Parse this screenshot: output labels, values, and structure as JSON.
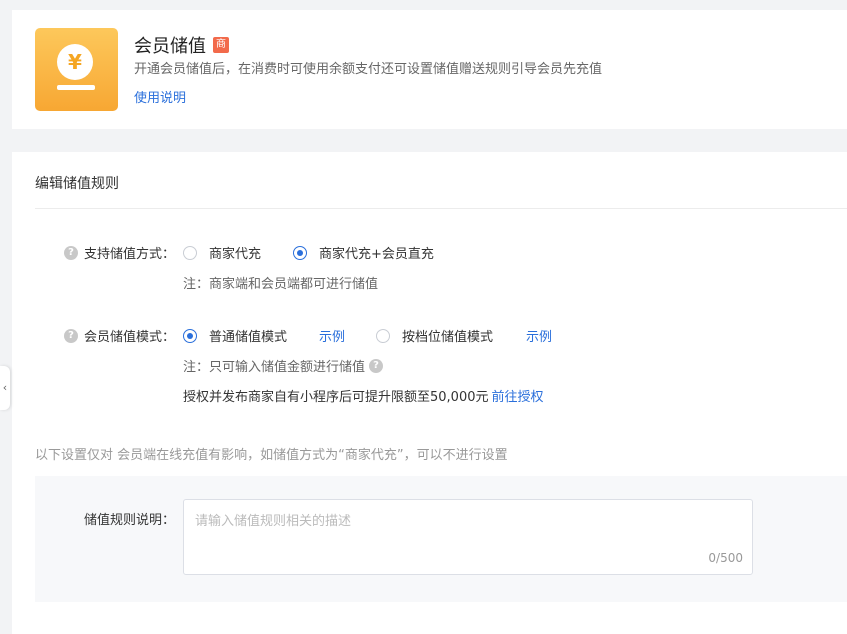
{
  "header": {
    "icon_symbol": "¥",
    "title": "会员储值",
    "badge": "商",
    "subtitle": "开通会员储值后，在消费时可使用余额支付还可设置储值赠送规则引导会员先充值",
    "help_link": "使用说明"
  },
  "rules": {
    "section_title": "编辑储值规则",
    "method": {
      "label": "支持储值方式：",
      "options": [
        {
          "label": "商家代充",
          "checked": false
        },
        {
          "label": "商家代充+会员直充",
          "checked": true
        }
      ],
      "note": "注：商家端和会员端都可进行储值"
    },
    "mode": {
      "label": "会员储值模式：",
      "options": [
        {
          "label": "普通储值模式",
          "example": "示例",
          "checked": true
        },
        {
          "label": "按档位储值模式",
          "example": "示例",
          "checked": false
        }
      ],
      "note": "注：只可输入储值金额进行储值",
      "auth_text": "授权并发布商家自有小程序后可提升限额至50,000元",
      "auth_link": "前往授权"
    },
    "hint": "以下设置仅对 会员端在线充值有影响，如储值方式为“商家代充”，可以不进行设置",
    "description": {
      "label": "储值规则说明：",
      "placeholder": "请输入储值规则相关的描述",
      "counter": "0/500"
    }
  },
  "side_handle": "‹",
  "colors": {
    "accent": "#2a6fdb",
    "badge": "#f26a4b",
    "icon_gradient_top": "#fdc85b",
    "icon_gradient_bottom": "#f7a733"
  }
}
